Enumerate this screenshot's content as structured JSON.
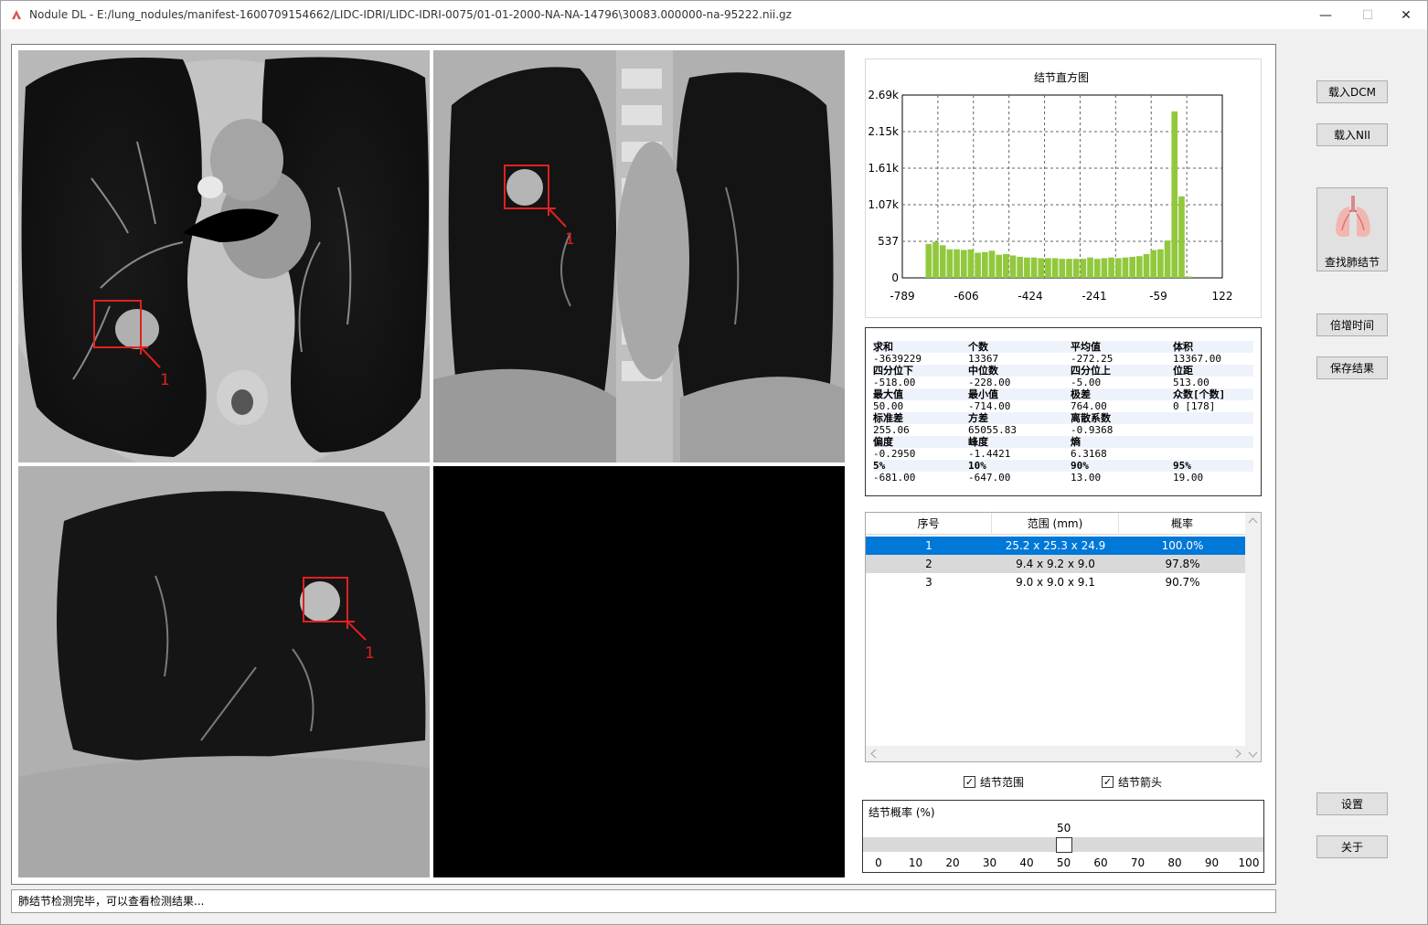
{
  "window": {
    "title": "Nodule DL - E:/lung_nodules/manifest-1600709154662/LIDC-IDRI/LIDC-IDRI-0075/01-01-2000-NA-NA-14796\\30083.000000-na-95222.nii.gz",
    "minimize": "—",
    "maximize": "☐",
    "close": "✕"
  },
  "viewers": {
    "axial_label": "1",
    "coronal_label": "1",
    "sagittal_label": "1"
  },
  "histogram": {
    "title": "结节直方图"
  },
  "chart_data": {
    "type": "bar",
    "title": "结节直方图",
    "xlabel": "",
    "ylabel": "",
    "x_ticks": [
      "-789",
      "-606",
      "-424",
      "-241",
      "-59",
      "122"
    ],
    "y_ticks": [
      "0",
      "537",
      "1.07k",
      "1.61k",
      "2.15k",
      "2.69k"
    ],
    "xlim": [
      -789,
      122
    ],
    "ylim": [
      0,
      2690
    ],
    "bin_width": 20,
    "grid": true,
    "bars": [
      {
        "x": -714,
        "y": 500
      },
      {
        "x": -694,
        "y": 530
      },
      {
        "x": -674,
        "y": 480
      },
      {
        "x": -654,
        "y": 420
      },
      {
        "x": -634,
        "y": 420
      },
      {
        "x": -614,
        "y": 410
      },
      {
        "x": -594,
        "y": 420
      },
      {
        "x": -574,
        "y": 370
      },
      {
        "x": -554,
        "y": 380
      },
      {
        "x": -534,
        "y": 400
      },
      {
        "x": -514,
        "y": 340
      },
      {
        "x": -494,
        "y": 350
      },
      {
        "x": -474,
        "y": 330
      },
      {
        "x": -454,
        "y": 310
      },
      {
        "x": -434,
        "y": 300
      },
      {
        "x": -414,
        "y": 300
      },
      {
        "x": -394,
        "y": 290
      },
      {
        "x": -374,
        "y": 290
      },
      {
        "x": -354,
        "y": 290
      },
      {
        "x": -334,
        "y": 280
      },
      {
        "x": -314,
        "y": 280
      },
      {
        "x": -294,
        "y": 280
      },
      {
        "x": -274,
        "y": 280
      },
      {
        "x": -254,
        "y": 300
      },
      {
        "x": -234,
        "y": 280
      },
      {
        "x": -214,
        "y": 290
      },
      {
        "x": -194,
        "y": 300
      },
      {
        "x": -174,
        "y": 290
      },
      {
        "x": -154,
        "y": 300
      },
      {
        "x": -134,
        "y": 310
      },
      {
        "x": -114,
        "y": 320
      },
      {
        "x": -94,
        "y": 350
      },
      {
        "x": -74,
        "y": 410
      },
      {
        "x": -54,
        "y": 420
      },
      {
        "x": -34,
        "y": 550
      },
      {
        "x": -14,
        "y": 2450
      },
      {
        "x": 6,
        "y": 1200
      },
      {
        "x": 26,
        "y": 20
      }
    ],
    "bar_color": "#92c83e"
  },
  "stats": {
    "rows": [
      {
        "a": "求和",
        "b": "个数",
        "c": "平均值",
        "d": "体积",
        "bold": true
      },
      {
        "a": "-3639229",
        "b": "13367",
        "c": "-272.25",
        "d": "13367.00",
        "bold": false
      },
      {
        "a": "四分位下",
        "b": "中位数",
        "c": "四分位上",
        "d": "位距",
        "bold": true
      },
      {
        "a": "-518.00",
        "b": "-228.00",
        "c": "-5.00",
        "d": "513.00",
        "bold": false
      },
      {
        "a": "最大值",
        "b": "最小值",
        "c": "极差",
        "d": "众数[个数]",
        "bold": true
      },
      {
        "a": "50.00",
        "b": "-714.00",
        "c": "764.00",
        "d": "0 [178]",
        "bold": false
      },
      {
        "a": "标准差",
        "b": "方差",
        "c": "离散系数",
        "d": "",
        "bold": true
      },
      {
        "a": "255.06",
        "b": "65055.83",
        "c": "-0.9368",
        "d": "",
        "bold": false
      },
      {
        "a": "偏度",
        "b": "峰度",
        "c": "熵",
        "d": "",
        "bold": true
      },
      {
        "a": "-0.2950",
        "b": "-1.4421",
        "c": "6.3168",
        "d": "",
        "bold": false
      },
      {
        "a": "5%",
        "b": "10%",
        "c": "90%",
        "d": "95%",
        "bold": true
      },
      {
        "a": "-681.00",
        "b": "-647.00",
        "c": "13.00",
        "d": "19.00",
        "bold": false
      }
    ]
  },
  "table": {
    "headers": [
      "序号",
      "范围 (mm)",
      "概率"
    ],
    "rows": [
      {
        "idx": "1",
        "range": "25.2 x 25.3 x 24.9",
        "prob": "100.0%",
        "selected": true
      },
      {
        "idx": "2",
        "range": "9.4 x 9.2 x 9.0",
        "prob": "97.8%",
        "selected": false
      },
      {
        "idx": "3",
        "range": "9.0 x 9.0 x 9.1",
        "prob": "90.7%",
        "selected": false
      }
    ]
  },
  "checkboxes": {
    "range_label": "结节范围",
    "range_checked": true,
    "arrow_label": "结节箭头",
    "arrow_checked": true
  },
  "probability": {
    "label": "结节概率 (%)",
    "value": "50",
    "value_fraction": 0.5,
    "ticks": [
      "0",
      "10",
      "20",
      "30",
      "40",
      "50",
      "60",
      "70",
      "80",
      "90",
      "100"
    ]
  },
  "buttons": {
    "load_dcm": "载入DCM",
    "load_nii": "载入NII",
    "find_nodule": "查找肺结节",
    "doubling_time": "倍增时间",
    "save_result": "保存结果",
    "settings": "设置",
    "about": "关于"
  },
  "status": {
    "text": "肺结节检测完毕，可以查看检测结果..."
  }
}
